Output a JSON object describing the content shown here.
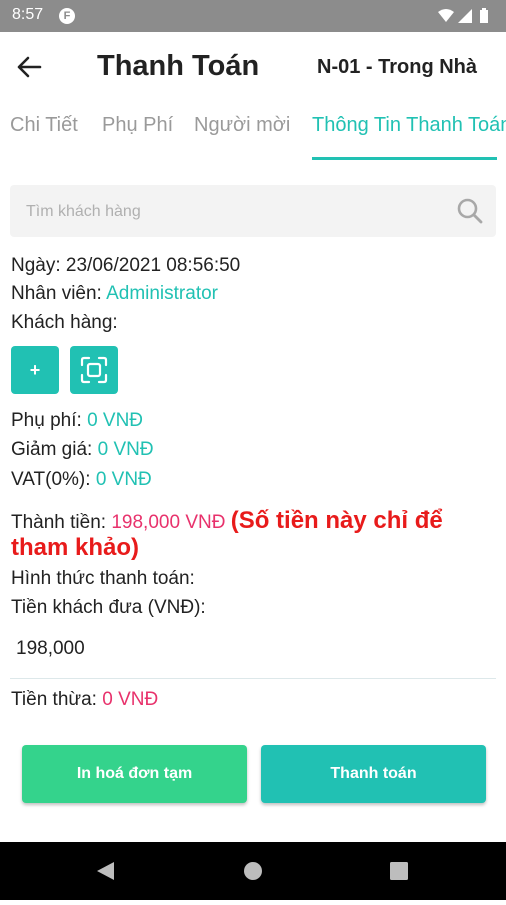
{
  "status_bar": {
    "time": "8:57",
    "app_icon": "F"
  },
  "header": {
    "title": "Thanh Toán",
    "table": "N-01 - Trong Nhà"
  },
  "tabs": [
    {
      "label": "Chi Tiết",
      "active": false
    },
    {
      "label": "Phụ Phí",
      "active": false
    },
    {
      "label": "Người mời",
      "active": false
    },
    {
      "label": "Thông Tin Thanh Toán",
      "active": true
    }
  ],
  "search": {
    "placeholder": "Tìm khách hàng"
  },
  "info": {
    "date_label": "Ngày:",
    "date_value": "23/06/2021 08:56:50",
    "staff_label": "Nhân viên:",
    "staff_value": "Administrator",
    "customer_label": "Khách hàng:"
  },
  "customer_actions": {
    "add_label": "+"
  },
  "fees": {
    "surcharge_label": "Phụ phí:",
    "surcharge_value": "0 VNĐ",
    "discount_label": "Giảm giá:",
    "discount_value": "0 VNĐ",
    "vat_label": "VAT(0%):",
    "vat_value": "0 VNĐ"
  },
  "total": {
    "label": "Thành tiền:",
    "value": "198,000 VNĐ",
    "note_line1": "(Số tiền này chỉ để",
    "note_line2": "tham khảo)"
  },
  "payment": {
    "method_label": "Hình thức thanh toán:",
    "cash_label": "Tiền khách đưa (VNĐ):",
    "cash_value": "198,000",
    "change_label": "Tiền thừa:",
    "change_value": "0 VNĐ"
  },
  "buttons": {
    "temp_invoice": "In hoá đơn tạm",
    "pay": "Thanh toán"
  },
  "colors": {
    "accent": "#21c1b3",
    "green": "#34d38c",
    "pink": "#e8326c",
    "red": "#e81b1b"
  }
}
